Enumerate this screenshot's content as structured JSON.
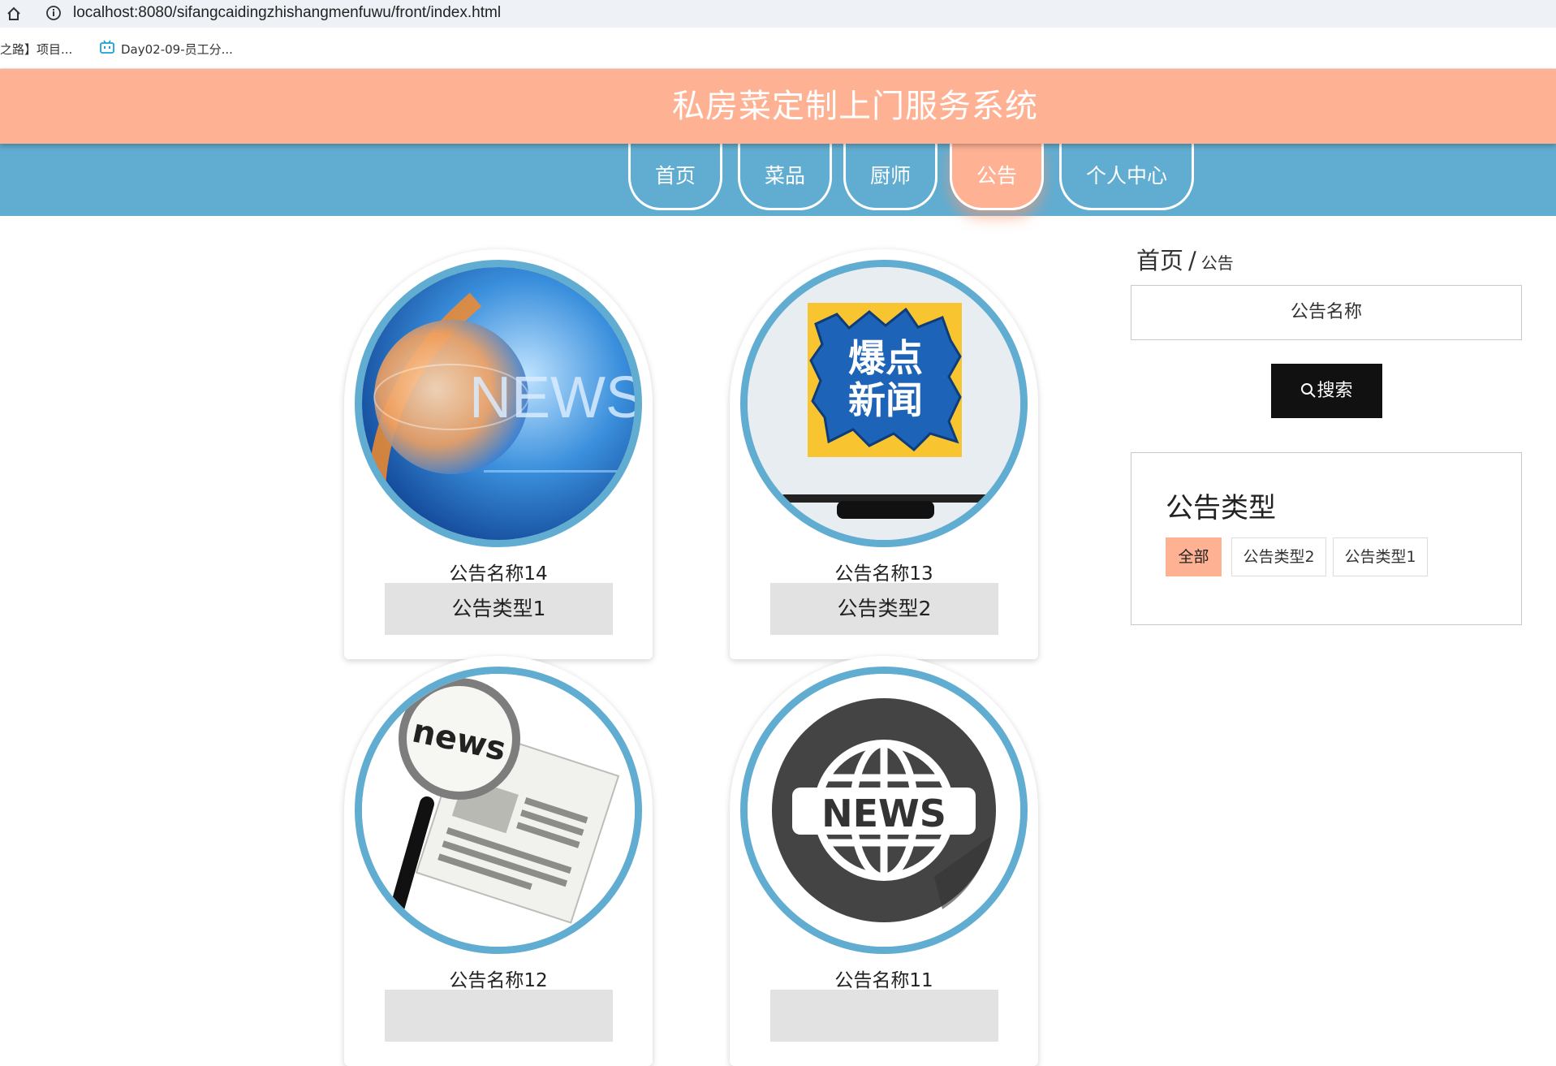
{
  "browser": {
    "url": "localhost:8080/sifangcaidingzhishangmenfuwu/front/index.html",
    "bookmarks": [
      "之路】项目...",
      "Day02-09-员工分..."
    ]
  },
  "header": {
    "title": "私房菜定制上门服务系统"
  },
  "nav": {
    "items": [
      {
        "label": "首页"
      },
      {
        "label": "菜品"
      },
      {
        "label": "厨师"
      },
      {
        "label": "公告",
        "active": true
      },
      {
        "label": "个人中心"
      }
    ]
  },
  "cards": [
    {
      "name": "公告名称14",
      "type": "公告类型1",
      "image": "news-globe-image"
    },
    {
      "name": "公告名称13",
      "type": "公告类型2",
      "image": "breaking-news-image",
      "image_text": [
        "爆点",
        "新闻"
      ]
    },
    {
      "name": "公告名称12",
      "type": "",
      "image": "newspaper-magnifier-image",
      "image_text": "news"
    },
    {
      "name": "公告名称11",
      "type": "",
      "image": "news-globe-icon-image",
      "image_text": "NEWS"
    }
  ],
  "card1_image_text": "NEWS",
  "sidebar": {
    "breadcrumb": {
      "home": "首页",
      "separator": "/",
      "current": "公告"
    },
    "search": {
      "placeholder": "公告名称",
      "button_label": "搜索"
    },
    "type_panel": {
      "title": "公告类型",
      "tags": [
        {
          "label": "全部",
          "active": true
        },
        {
          "label": "公告类型2"
        },
        {
          "label": "公告类型1"
        }
      ]
    }
  },
  "colors": {
    "header_bg": "#ffb194",
    "nav_bg": "#61add1",
    "accent": "#ffb194",
    "search_button": "#111111",
    "card_border": "#61add1"
  }
}
